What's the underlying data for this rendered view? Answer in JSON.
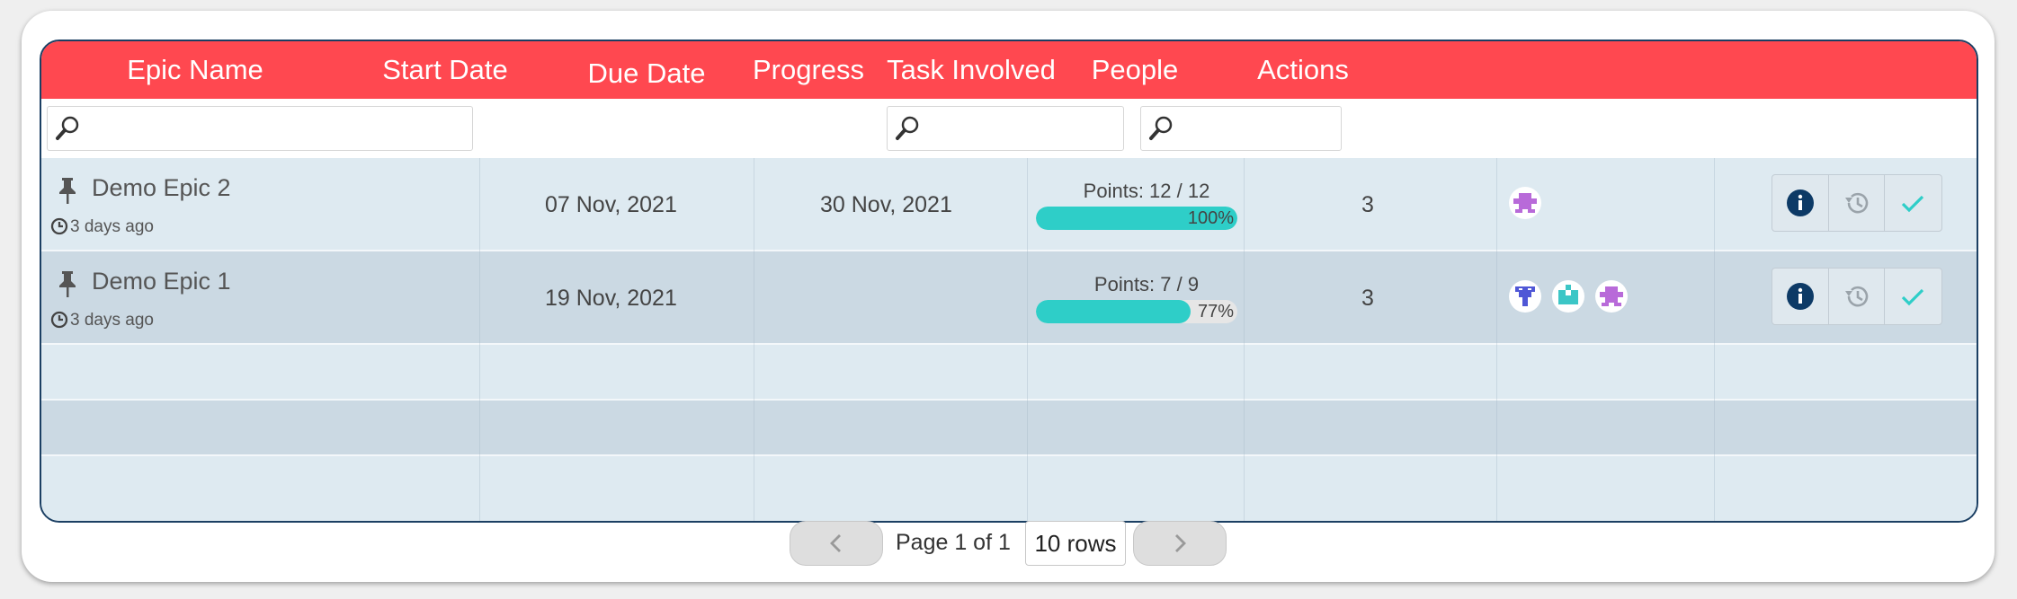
{
  "columns": [
    {
      "label": "Epic Name"
    },
    {
      "label": "Start Date"
    },
    {
      "label": "Due Date"
    },
    {
      "label": "Progress"
    },
    {
      "label": "Task Involved"
    },
    {
      "label": "People"
    },
    {
      "label": "Actions"
    }
  ],
  "filters": {
    "epic_name_placeholder": "",
    "task_involved_placeholder": "",
    "people_placeholder": "",
    "icon": "search-icon"
  },
  "rows": [
    {
      "name": "Demo Epic 2",
      "updated": "3 days ago",
      "start": "07 Nov, 2021",
      "due": "30 Nov, 2021",
      "points": "Points: 12 / 12",
      "progress_pct": 100,
      "progress_label": "100%",
      "tasks": "3",
      "people": [
        "avatar-purple"
      ]
    },
    {
      "name": "Demo Epic 1",
      "updated": "3 days ago",
      "start": "19 Nov, 2021",
      "due": "",
      "points": "Points: 7 / 9",
      "progress_pct": 77,
      "progress_label": "77%",
      "tasks": "3",
      "people": [
        "avatar-blue",
        "avatar-teal",
        "avatar-purple"
      ]
    }
  ],
  "actions": [
    "info-icon",
    "history-icon",
    "check-icon"
  ],
  "pagination": {
    "prev_icon": "chevron-left-icon",
    "next_icon": "chevron-right-icon",
    "page_text": "Page 1 of 1",
    "rows_select": "10 rows"
  },
  "colors": {
    "header": "#ff4850",
    "progress": "#2ecec8",
    "info": "#0d3a66",
    "check": "#2ecec8",
    "history": "#9aa3aa"
  }
}
